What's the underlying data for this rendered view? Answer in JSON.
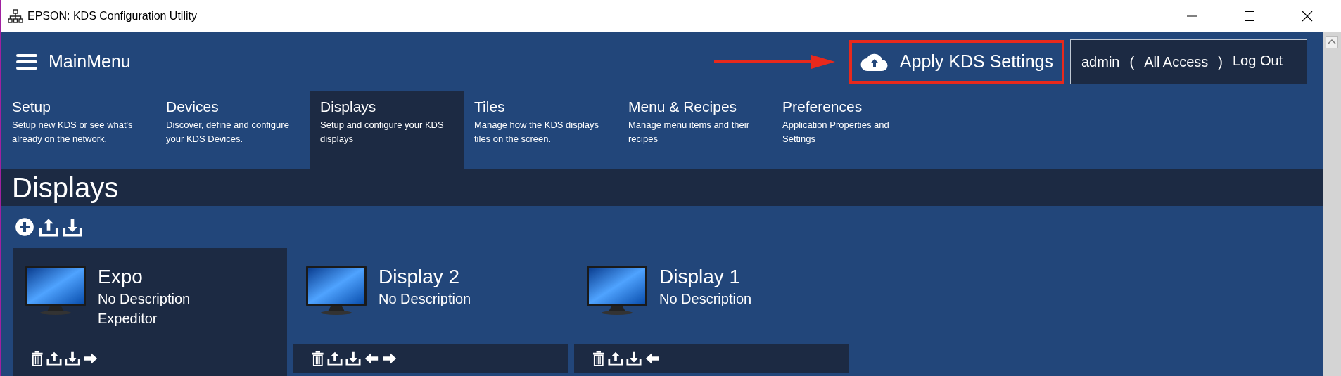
{
  "window": {
    "title": "EPSON: KDS Configuration Utility"
  },
  "main_menu": {
    "label": "MainMenu"
  },
  "apply_button": {
    "label": "Apply KDS Settings",
    "highlighted": true
  },
  "user": {
    "name": "admin",
    "open_paren": "(",
    "access": "All Access",
    "close_paren": ")",
    "logout": "Log Out"
  },
  "tabs": [
    {
      "title": "Setup",
      "description": "Setup new KDS or see what's already on the network.",
      "selected": false
    },
    {
      "title": "Devices",
      "description": "Discover, define and configure your KDS Devices.",
      "selected": false
    },
    {
      "title": "Displays",
      "description": "Setup and configure your KDS displays",
      "selected": true
    },
    {
      "title": "Tiles",
      "description": "Manage how the KDS displays tiles on the screen.",
      "selected": false
    },
    {
      "title": "Menu & Recipes",
      "description": "Manage menu items and their recipes",
      "selected": false
    },
    {
      "title": "Preferences",
      "description": "Application Properties and Settings",
      "selected": false
    }
  ],
  "page_title": "Displays",
  "toolbar": [
    {
      "kind": "add"
    },
    {
      "kind": "upload"
    },
    {
      "kind": "download"
    }
  ],
  "displays": [
    {
      "name": "Expo",
      "description": "No Description",
      "role": "Expeditor",
      "selected": true,
      "actions": [
        {
          "kind": "delete"
        },
        {
          "kind": "upload"
        },
        {
          "kind": "download"
        },
        {
          "kind": "right"
        }
      ]
    },
    {
      "name": "Display 2",
      "description": "No Description",
      "selected": false,
      "actions": [
        {
          "kind": "delete"
        },
        {
          "kind": "upload"
        },
        {
          "kind": "download"
        },
        {
          "kind": "left"
        },
        {
          "kind": "right"
        }
      ]
    },
    {
      "name": "Display 1",
      "description": "No Description",
      "selected": false,
      "actions": [
        {
          "kind": "delete"
        },
        {
          "kind": "upload"
        },
        {
          "kind": "download"
        },
        {
          "kind": "left"
        }
      ]
    }
  ]
}
